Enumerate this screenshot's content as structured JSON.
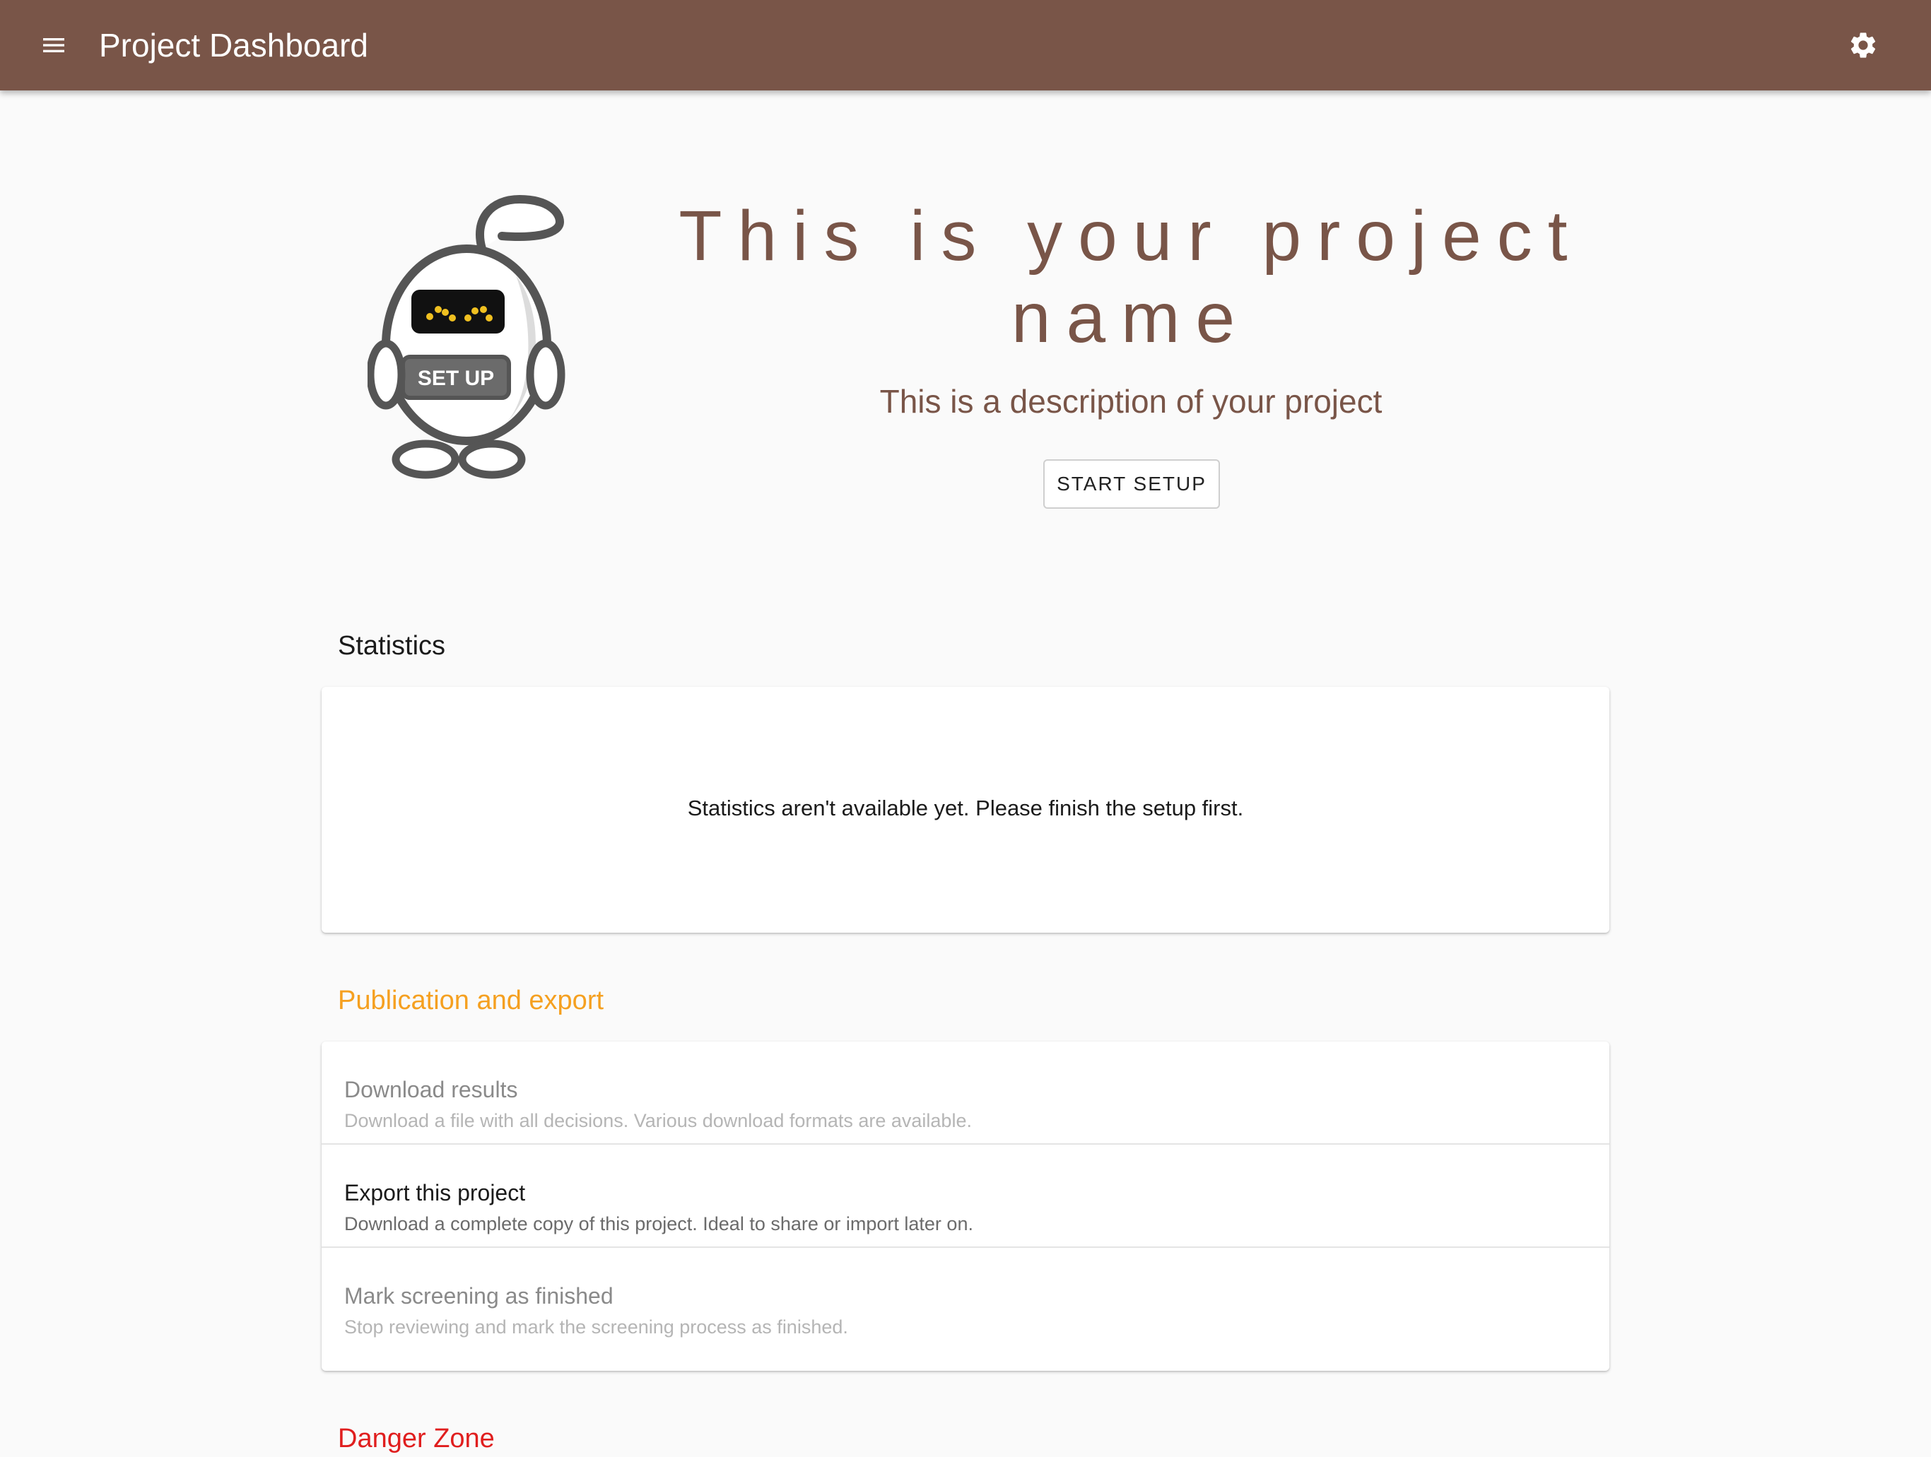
{
  "appbar": {
    "title": "Project Dashboard",
    "menu_icon": "menu-icon",
    "settings_icon": "gear-icon",
    "background": "#795548"
  },
  "hero": {
    "mascot_badge": "SET UP",
    "title": "This is your project name",
    "description": "This is a description of your project",
    "start_button": "START SETUP"
  },
  "statistics": {
    "heading": "Statistics",
    "message": "Statistics aren't available yet. Please finish the setup first."
  },
  "publication": {
    "heading": "Publication and export",
    "heading_color": "#f5a020",
    "items": [
      {
        "title": "Download results",
        "subtitle": "Download a file with all decisions. Various download formats are available.",
        "enabled": false
      },
      {
        "title": "Export this project",
        "subtitle": "Download a complete copy of this project. Ideal to share or import later on.",
        "enabled": true
      },
      {
        "title": "Mark screening as finished",
        "subtitle": "Stop reviewing and mark the screening process as finished.",
        "enabled": false
      }
    ]
  },
  "danger": {
    "heading": "Danger Zone",
    "heading_color": "#e01e1e"
  }
}
